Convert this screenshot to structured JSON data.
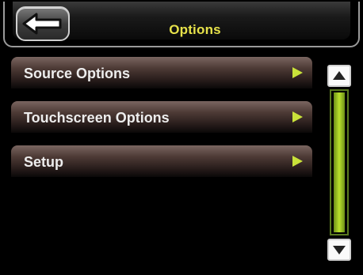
{
  "header": {
    "title": "Options",
    "back_icon": "back-arrow-icon"
  },
  "menu": {
    "items": [
      {
        "label": "Source Options",
        "icon": "chevron-right-icon"
      },
      {
        "label": "Touchscreen Options",
        "icon": "chevron-right-icon"
      },
      {
        "label": "Setup",
        "icon": "chevron-right-icon"
      }
    ]
  },
  "scrollbar": {
    "up_icon": "scroll-up-icon",
    "down_icon": "scroll-down-icon",
    "position_fraction": 0.0,
    "visible_fraction": 1.0
  },
  "colors": {
    "accent": "#c9e23a",
    "title": "#e7e24a",
    "background": "#000000"
  }
}
